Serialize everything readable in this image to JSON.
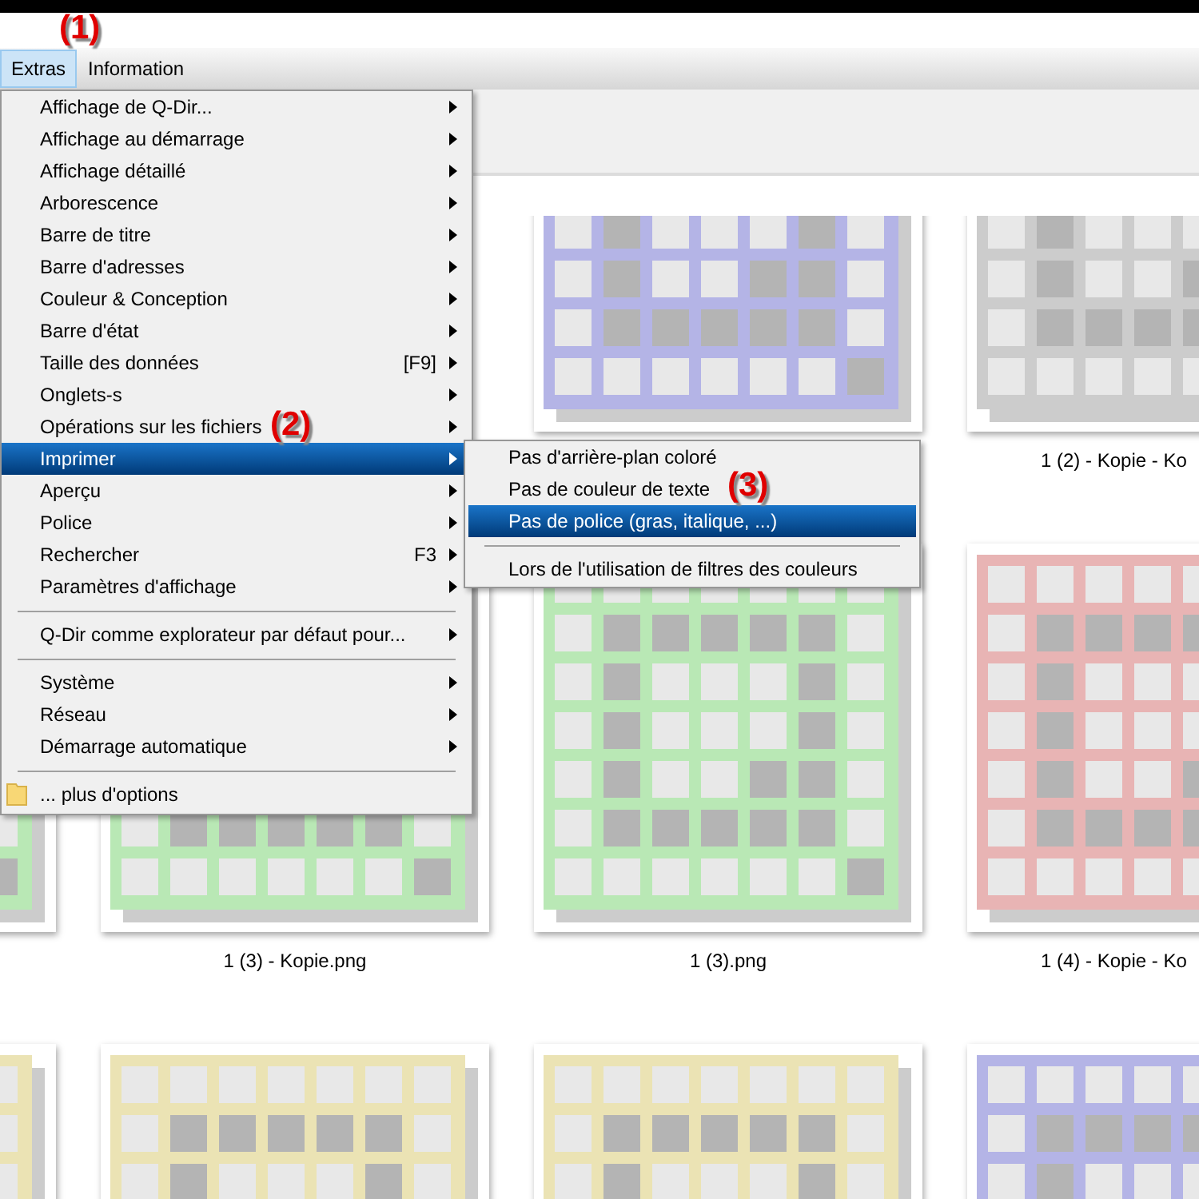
{
  "annotations": [
    {
      "text": "(1)"
    },
    {
      "text": "(2)"
    },
    {
      "text": "(3)"
    }
  ],
  "menu_bar": [
    {
      "label": "Extras",
      "selected": true
    },
    {
      "label": "Information",
      "selected": false
    }
  ],
  "menu": [
    {
      "kind": "item",
      "label": "Affichage de Q-Dir...",
      "submenu": true,
      "selected": false
    },
    {
      "kind": "item",
      "label": "Affichage au démarrage",
      "submenu": true,
      "selected": false
    },
    {
      "kind": "item",
      "label": "Affichage détaillé",
      "submenu": true,
      "selected": false
    },
    {
      "kind": "item",
      "label": "Arborescence",
      "submenu": true,
      "selected": false
    },
    {
      "kind": "item",
      "label": "Barre de titre",
      "submenu": true,
      "selected": false
    },
    {
      "kind": "item",
      "label": "Barre d'adresses",
      "submenu": true,
      "selected": false
    },
    {
      "kind": "item",
      "label": "Couleur & Conception",
      "submenu": true,
      "selected": false
    },
    {
      "kind": "item",
      "label": "Barre d'état",
      "submenu": true,
      "selected": false
    },
    {
      "kind": "item",
      "label": "Taille des données",
      "shortcut": "[F9]",
      "submenu": true,
      "selected": false
    },
    {
      "kind": "item",
      "label": "Onglets-s",
      "submenu": true,
      "selected": false
    },
    {
      "kind": "item",
      "label": "Opérations sur les fichiers",
      "submenu": true,
      "selected": false
    },
    {
      "kind": "item",
      "label": "Imprimer",
      "submenu": true,
      "selected": true
    },
    {
      "kind": "item",
      "label": "Aperçu",
      "submenu": true,
      "selected": false
    },
    {
      "kind": "item",
      "label": "Police",
      "submenu": true,
      "selected": false
    },
    {
      "kind": "item",
      "label": "Rechercher",
      "shortcut": "F3",
      "submenu": true,
      "selected": false
    },
    {
      "kind": "item",
      "label": "Paramètres d'affichage",
      "submenu": true,
      "selected": false
    },
    {
      "kind": "separator"
    },
    {
      "kind": "item",
      "label": "Q-Dir comme explorateur par défaut pour...",
      "submenu": true,
      "selected": false
    },
    {
      "kind": "separator"
    },
    {
      "kind": "item",
      "label": "Système",
      "submenu": true,
      "selected": false
    },
    {
      "kind": "item",
      "label": "Réseau",
      "submenu": true,
      "selected": false
    },
    {
      "kind": "item",
      "label": "Démarrage automatique",
      "submenu": true,
      "selected": false
    },
    {
      "kind": "separator"
    },
    {
      "kind": "folder-item",
      "label": "... plus d'options",
      "submenu": false,
      "selected": false
    }
  ],
  "submenu": [
    {
      "kind": "item",
      "label": "Pas d'arrière-plan coloré",
      "selected": false
    },
    {
      "kind": "item",
      "label": "Pas de couleur de texte",
      "selected": false
    },
    {
      "kind": "item",
      "label": "Pas de police (gras, italique, ...)",
      "selected": true
    },
    {
      "kind": "separator"
    },
    {
      "kind": "item",
      "label": "Lors de l'utilisation de filtres des couleurs",
      "selected": false
    }
  ],
  "thumbnails": [
    {
      "tiles": [
        {
          "color": "#b4b4e6"
        },
        {
          "color": "#cccccc",
          "label": "1 (2) - Kopie - Ko"
        }
      ]
    },
    {
      "tiles": [
        {
          "color": "#b9e8b5"
        },
        {
          "color": "#b9e8b5",
          "label": "1 (3) - Kopie.png"
        },
        {
          "color": "#b9e8b5",
          "label": "1 (3).png"
        },
        {
          "color": "#e8b4b4",
          "label": "1 (4) - Kopie - Ko"
        }
      ]
    },
    {
      "tiles": [
        {
          "color": "#ebe3b4"
        },
        {
          "color": "#ebe3b4"
        },
        {
          "color": "#ebe3b4"
        },
        {
          "color": "#b4b4e6"
        }
      ]
    }
  ]
}
